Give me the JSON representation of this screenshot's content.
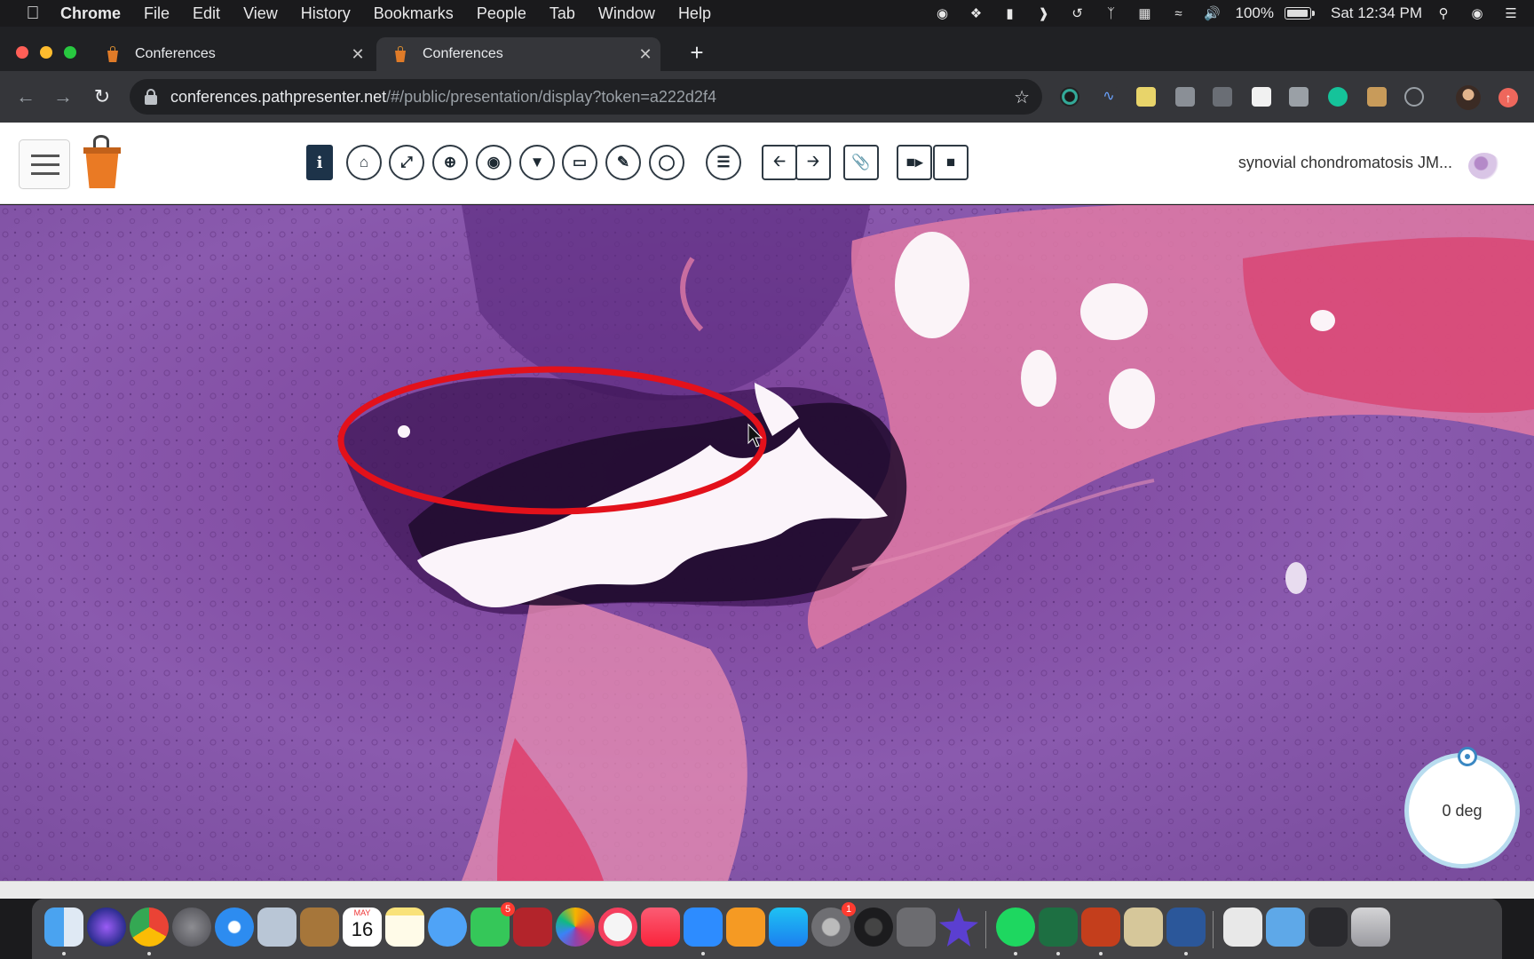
{
  "menubar": {
    "apple_icon": "apple-icon",
    "app_name": "Chrome",
    "items": [
      "File",
      "Edit",
      "View",
      "History",
      "Bookmarks",
      "People",
      "Tab",
      "Window",
      "Help"
    ],
    "battery_percent": "100%",
    "battery_level": 1.0,
    "clock": "Sat 12:34 PM"
  },
  "browser": {
    "tabs": [
      {
        "title": "Conferences",
        "active": false
      },
      {
        "title": "Conferences",
        "active": true
      }
    ],
    "url_host": "conferences.pathpresenter.net",
    "url_path": "/#/public/presentation/display?token=a222d2f4"
  },
  "app": {
    "presentation_title": "synovial chondromatosis JM...",
    "toolbar_icons": [
      "info-icon",
      "home-icon",
      "fullscreen-icon",
      "zoom-icon",
      "camera-icon",
      "filter-icon",
      "monitor-icon",
      "pencil-icon",
      "lasso-icon",
      "list-icon",
      "arrow-left-icon",
      "arrow-right-icon",
      "paperclip-icon",
      "video-icon",
      "stop-icon"
    ],
    "rotation_label": "0 deg",
    "annotation_color": "#e3111b"
  },
  "dock": {
    "apps": [
      "Finder",
      "Siri",
      "Chrome",
      "Launchpad",
      "Safari",
      "Mail Bird",
      "Notefile",
      "Calendar",
      "Notes",
      "Messages",
      "FaceTime",
      "Photo Booth",
      "Photos",
      "News",
      "Music",
      "Zoom",
      "Books",
      "App Store",
      "System Preferences",
      "QuickTime",
      "Utilities",
      "iMovie",
      "Spotify",
      "Excel",
      "PowerPoint",
      "Installer",
      "Word",
      "Preview",
      "Downloads",
      "Screen",
      "Trash"
    ],
    "calendar_month": "MAY",
    "calendar_day": "16",
    "facetime_badge": "5",
    "prefs_badge": "1"
  }
}
